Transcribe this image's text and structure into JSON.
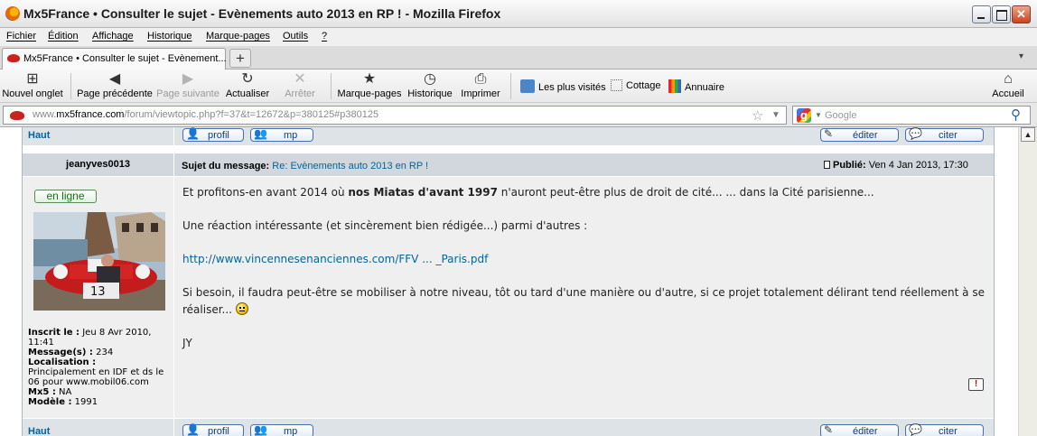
{
  "window": {
    "title": "Mx5France • Consulter le sujet - Evènements auto 2013 en RP ! - Mozilla Firefox"
  },
  "menu": [
    "Fichier",
    "Édition",
    "Affichage",
    "Historique",
    "Marque-pages",
    "Outils",
    "?"
  ],
  "tab": {
    "label": "Mx5France • Consulter le sujet - Evènement...",
    "new_tab": "+"
  },
  "toolbar": {
    "new_tab": "Nouvel onglet",
    "back": "Page précédente",
    "forward": "Page suivante",
    "reload": "Actualiser",
    "stop": "Arrêter",
    "bookmarks": "Marque-pages",
    "history": "Historique",
    "print": "Imprimer",
    "home": "Accueil",
    "bm_most_visited": "Les plus visités",
    "bm_cottage": "Cottage",
    "bm_annuaire": "Annuaire"
  },
  "urlbar": {
    "prefix": "www.",
    "domain": "mx5france.com",
    "path": "/forum/viewtopic.php?f=37&t=12672&p=380125#p380125",
    "search_placeholder": "Google"
  },
  "post": {
    "top_link": "Haut",
    "buttons": {
      "profile": "profil",
      "pm": "mp",
      "edit": "éditer",
      "quote": "citer"
    },
    "author": "jeanyves0013",
    "subject_label": "Sujet du message:",
    "subject": "Re: Evènements auto 2013 en RP !",
    "published_label": "Publié:",
    "published_date": "Ven 4 Jan 2013, 17:30",
    "online_status": "en ligne",
    "profile": {
      "registered_label": "Inscrit le :",
      "registered": "Jeu 8 Avr 2010, 11:41",
      "messages_label": "Message(s) :",
      "messages": "234",
      "location_label": "Localisation :",
      "location": "Principalement en IDF et ds le 06 pour www.mobil06.com",
      "mx5_label": "Mx5 :",
      "mx5": "NA",
      "model_label": "Modèle :",
      "model": "1991"
    },
    "body": {
      "p1_before": "Et profitons-en avant 2014 où ",
      "p1_bold": "nos Miatas d'avant 1997",
      "p1_after": " n'auront peut-être plus de droit de cité... ... dans la Cité parisienne...",
      "p2": "Une réaction intéressante (et sincèrement bien rédigée...) parmi d'autres :",
      "p3_link": "http://www.vincennesenanciennes.com/FFV ... _Paris.pdf",
      "p4": "Si besoin, il faudra peut-être se mobiliser à notre niveau, tôt ou tard d'une manière ou d'autre, si ce projet totalement délirant tend réellement à se réaliser...",
      "signature": "JY"
    },
    "report_icon": "!"
  },
  "colors": {
    "link": "#006699",
    "row_light": "#dee3e7",
    "row_mid": "#d1d7dc",
    "post_bg": "#efefef"
  }
}
